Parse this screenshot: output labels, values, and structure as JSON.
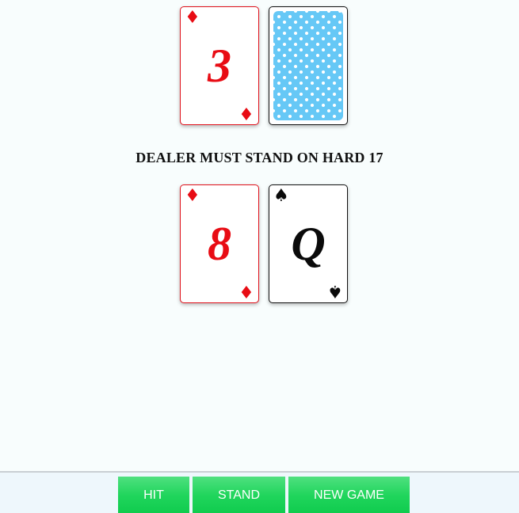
{
  "dealer": {
    "cards": [
      {
        "rank": "3",
        "suit": "♦",
        "suit_icon": "diamond-icon",
        "color": "#e80c14",
        "face_up": true
      },
      {
        "face_up": false,
        "back_color": "#66c8f6"
      }
    ]
  },
  "message": "DEALER MUST STAND ON HARD 17",
  "player": {
    "cards": [
      {
        "rank": "8",
        "suit": "♦",
        "suit_icon": "diamond-icon",
        "color": "#e80c14",
        "face_up": true
      },
      {
        "rank": "Q",
        "suit": "♠",
        "suit_icon": "spade-icon",
        "color": "#0a0a0a",
        "face_up": true
      }
    ]
  },
  "controls": {
    "hit_label": "HIT",
    "stand_label": "STAND",
    "new_game_label": "NEW GAME",
    "button_color": "#20d55c"
  }
}
